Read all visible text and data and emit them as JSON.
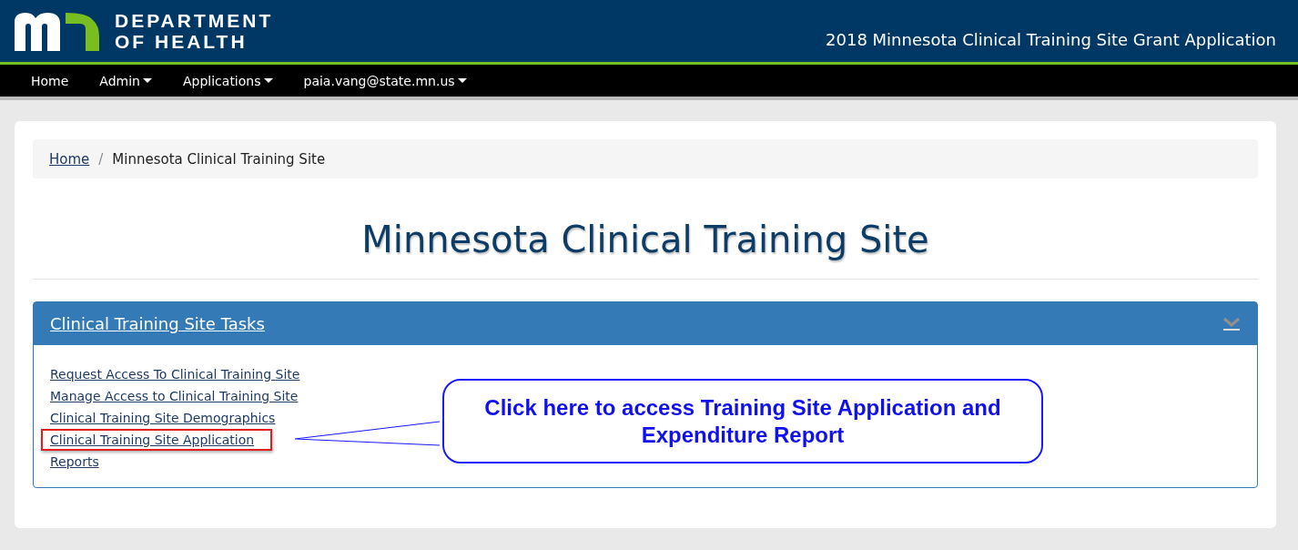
{
  "header": {
    "logo_lines": [
      "DEPARTMENT",
      "OF HEALTH"
    ],
    "app_title": "2018 Minnesota Clinical Training Site Grant Application"
  },
  "nav": [
    {
      "label": "Home",
      "dropdown": false
    },
    {
      "label": "Admin",
      "dropdown": true
    },
    {
      "label": "Applications",
      "dropdown": true
    },
    {
      "label": "paia.vang@state.mn.us",
      "dropdown": true
    }
  ],
  "breadcrumb": [
    {
      "label": "Home",
      "link": true
    },
    {
      "label": "Minnesota Clinical Training Site",
      "link": false,
      "separator": "/"
    }
  ],
  "page_title": "Minnesota Clinical Training Site",
  "panel": {
    "title": "Clinical Training Site Tasks",
    "expanded": true,
    "tasks": [
      {
        "label": "Request Access To Clinical Training Site",
        "highlighted": false
      },
      {
        "label": "Manage Access to Clinical Training Site",
        "highlighted": false
      },
      {
        "label": "Clinical Training Site Demographics",
        "highlighted": false
      },
      {
        "label": "Clinical Training Site Application",
        "highlighted": true
      },
      {
        "label": "Reports",
        "highlighted": false
      }
    ]
  },
  "callout": {
    "lines": [
      "Click here to access Training Site Application and",
      "Expenditure Report"
    ]
  }
}
